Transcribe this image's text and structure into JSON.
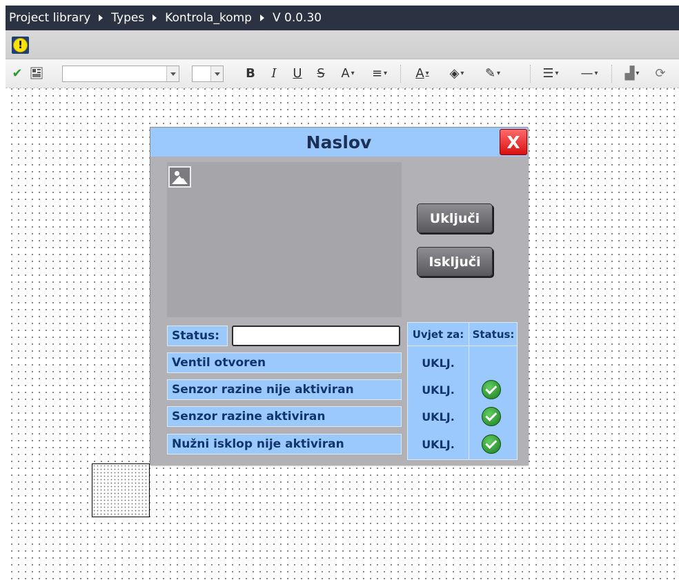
{
  "breadcrumb": {
    "items": [
      "Project library",
      "Types",
      "Kontrola_komp",
      "V 0.0.30"
    ]
  },
  "toolbar": {
    "icons": [
      "checkmark-icon",
      "layout-icon",
      "bold-icon",
      "italic-icon",
      "underline-icon",
      "strikethrough-icon",
      "font-size-icon",
      "align-icon",
      "text-color-icon",
      "fill-color-icon",
      "line-color-icon",
      "line-style-icon",
      "line-width-icon",
      "shadow-icon",
      "rotate-icon"
    ],
    "bold": "B",
    "italic": "I",
    "underline": "U",
    "strikethrough": "S",
    "font_size_glyph": "A",
    "text_color_glyph": "A"
  },
  "dialog": {
    "title": "Naslov",
    "close_label": "X",
    "button_on": "Uključi",
    "button_off": "Isključi",
    "status_label": "Status:",
    "status_value": "",
    "conditions": [
      {
        "label": "Ventil otvoren",
        "requirement": "UKLJ.",
        "ok": false
      },
      {
        "label": "Senzor razine nije aktiviran",
        "requirement": "UKLJ.",
        "ok": true
      },
      {
        "label": "Senzor razine aktiviran",
        "requirement": "UKLJ.",
        "ok": true
      },
      {
        "label": "Nužni isklop nije aktiviran",
        "requirement": "UKLJ.",
        "ok": true
      }
    ],
    "table_headers": {
      "condition": "Uvjet za:",
      "status": "Status:"
    }
  },
  "colors": {
    "titlebar_bg": "#2b3242",
    "dialog_header": "#9cc9fd",
    "close_button": "#e01818",
    "ok_green": "#1c7a22",
    "warning_yellow": "#ffe200"
  }
}
